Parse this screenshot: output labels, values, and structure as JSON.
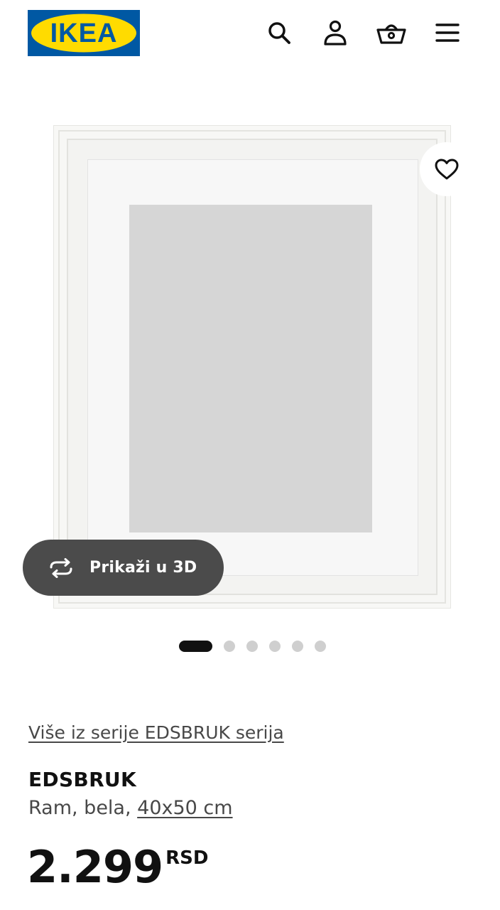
{
  "header": {
    "logo_text": "IKEA",
    "brand_colors": {
      "blue": "#0058a3",
      "yellow": "#ffdb00"
    },
    "icons": [
      "search-icon",
      "account-icon",
      "shopping-bag-icon",
      "menu-icon"
    ]
  },
  "gallery": {
    "view_3d_label": "Prikaži u 3D",
    "favorite_icon": "heart-icon",
    "dots_total": 6,
    "active_dot": 1
  },
  "product": {
    "series_link": "Više iz serije EDSBRUK serija",
    "name": "EDSBRUK",
    "description_prefix": "Ram, bela, ",
    "size": "40x50 cm",
    "price": "2.299",
    "currency": "RSD"
  }
}
